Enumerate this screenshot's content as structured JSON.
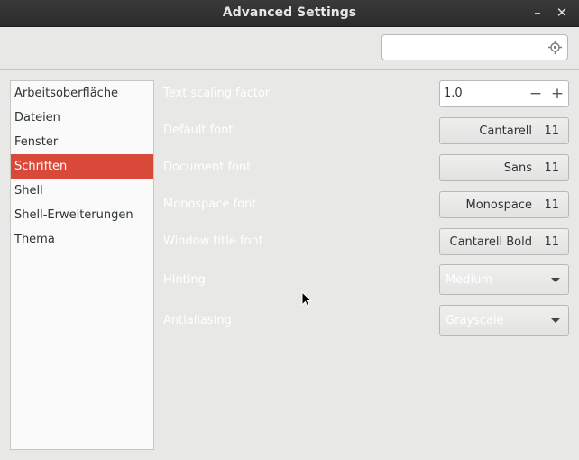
{
  "window": {
    "title": "Advanced Settings",
    "minimize_glyph": "–",
    "close_glyph": "✕"
  },
  "search": {
    "value": "",
    "icon": "locate-icon"
  },
  "sidebar": {
    "items": [
      {
        "label": "Arbeitsoberfläche",
        "selected": false
      },
      {
        "label": "Dateien",
        "selected": false
      },
      {
        "label": "Fenster",
        "selected": false
      },
      {
        "label": "Schriften",
        "selected": true
      },
      {
        "label": "Shell",
        "selected": false
      },
      {
        "label": "Shell-Erweiterungen",
        "selected": false
      },
      {
        "label": "Thema",
        "selected": false
      }
    ]
  },
  "settings": {
    "text_scaling": {
      "label": "Text scaling factor",
      "value": "1.0",
      "minus": "−",
      "plus": "+"
    },
    "default_font": {
      "label": "Default font",
      "family": "Cantarell",
      "size": "11"
    },
    "document_font": {
      "label": "Document font",
      "family": "Sans",
      "size": "11"
    },
    "monospace_font": {
      "label": "Monospace font",
      "family": "Monospace",
      "size": "11"
    },
    "window_title_font": {
      "label": "Window title font",
      "family": "Cantarell Bold",
      "size": "11"
    },
    "hinting": {
      "label": "Hinting",
      "value": "Medium"
    },
    "antialiasing": {
      "label": "Antialiasing",
      "value": "Grayscale"
    }
  },
  "colors": {
    "selection": "#d9493a",
    "titlebar": "#2b2b2b",
    "background": "#e8e8e7"
  }
}
